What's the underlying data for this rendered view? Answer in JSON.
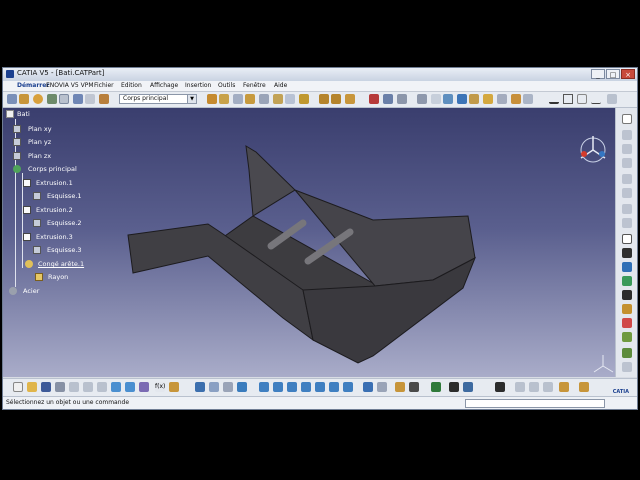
{
  "window": {
    "title": "CATIA V5 - [Bati.CATPart]"
  },
  "menu": {
    "items": [
      "Démarrer",
      "ENOVIA V5 VPM",
      "Fichier",
      "Edition",
      "Affichage",
      "Insertion",
      "Outils",
      "Fenêtre",
      "Aide"
    ]
  },
  "toolbar": {
    "body_selector_value": "Corps principal"
  },
  "tree": {
    "root": "Bati",
    "planes": [
      "Plan xy",
      "Plan yz",
      "Plan zx"
    ],
    "body": "Corps principal",
    "features": [
      {
        "name": "Extrusion.1",
        "sketch": "Esquisse.1"
      },
      {
        "name": "Extrusion.2",
        "sketch": "Esquisse.2"
      },
      {
        "name": "Extrusion.3",
        "sketch": "Esquisse.3"
      }
    ],
    "joint": "Congé arête.1",
    "joint_child": "Rayon",
    "material": "Acier"
  },
  "status": {
    "message": "Sélectionnez un objet ou une commande"
  },
  "brand": {
    "logo_text": "CATIA"
  },
  "colors": {
    "viewport_top": "#3a3e6e",
    "viewport_bottom": "#a9acc9",
    "part_dark": "#3d3c40",
    "part_edge": "#1c1b1e"
  }
}
